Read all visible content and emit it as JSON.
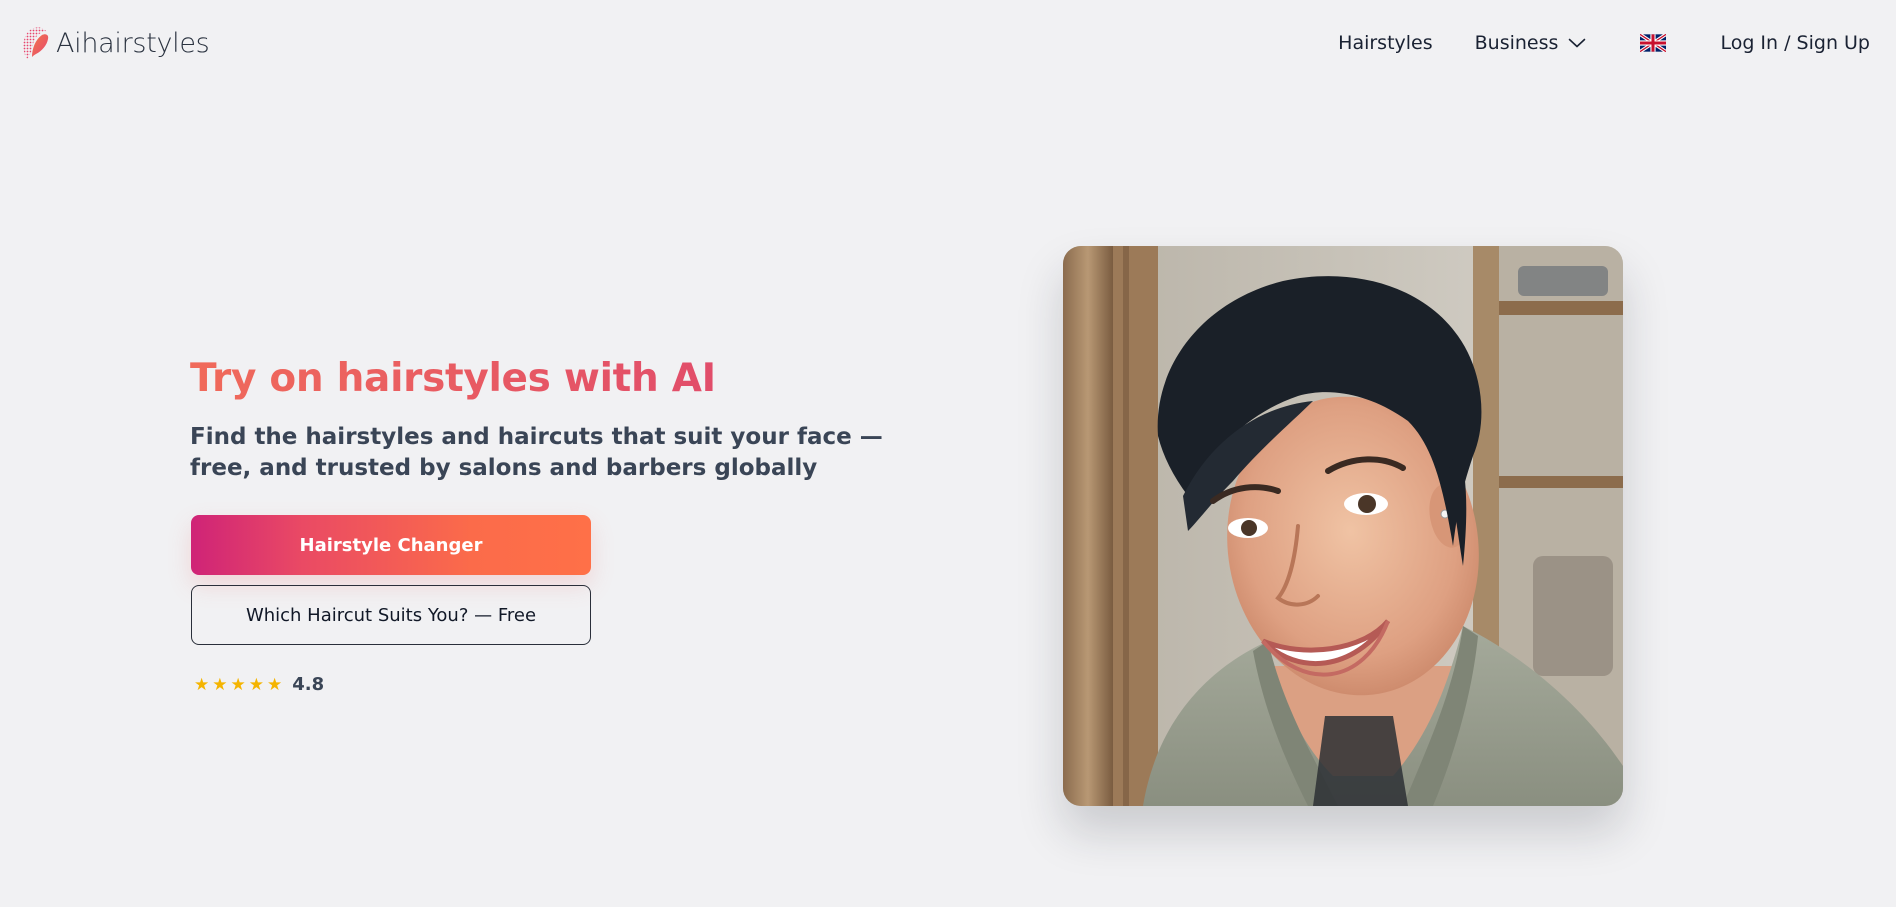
{
  "brand": {
    "name": "Aihairstyles",
    "logo_icon": "hair-profile-logo-icon",
    "colors": {
      "logo_start": "#e8456d",
      "logo_end": "#f0784e"
    }
  },
  "nav": {
    "hairstyles_label": "Hairstyles",
    "business_label": "Business",
    "business_icon": "chevron-down-icon",
    "language_icon": "uk-flag-icon",
    "login_label": "Log In / Sign Up"
  },
  "hero": {
    "title": "Try on hairstyles with AI",
    "subtitle": "Find the hairstyles and haircuts that suit your face — free, and trusted by salons and barbers globally",
    "primary_button": "Hairstyle Changer",
    "secondary_button": "Which Haircut Suits You? — Free",
    "rating": {
      "stars": 5,
      "value": "4.8"
    },
    "image_alt": "Smiling woman with a short dark pixie haircut",
    "colors": {
      "title_start": "#f06a5a",
      "title_end": "#e14d6a",
      "button_start": "#cf2377",
      "button_end": "#ff7048",
      "star": "#f4b400"
    }
  }
}
